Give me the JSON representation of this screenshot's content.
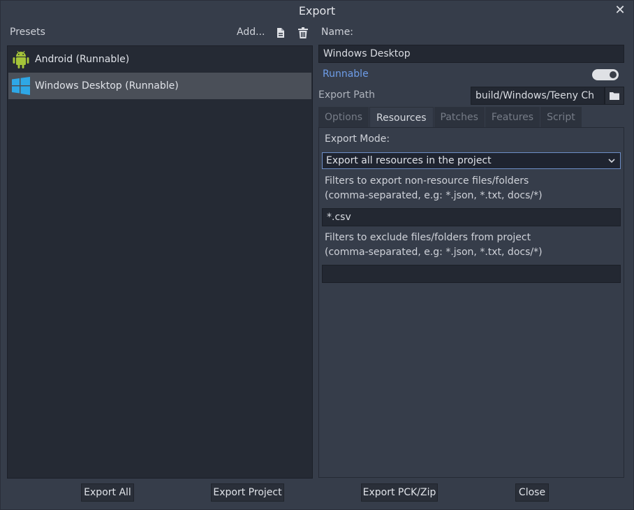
{
  "window": {
    "title": "Export"
  },
  "presets": {
    "label": "Presets",
    "add_label": "Add...",
    "items": [
      {
        "label": "Android (Runnable)",
        "icon": "android-icon",
        "selected": false
      },
      {
        "label": "Windows Desktop (Runnable)",
        "icon": "windows-icon",
        "selected": true
      }
    ]
  },
  "details": {
    "name_label": "Name:",
    "name_value": "Windows Desktop",
    "runnable_label": "Runnable",
    "runnable_on": true,
    "export_path_label": "Export Path",
    "export_path_value": "build/Windows/Teeny Ch",
    "tabs": [
      {
        "label": "Options",
        "active": false
      },
      {
        "label": "Resources",
        "active": true
      },
      {
        "label": "Patches",
        "active": false
      },
      {
        "label": "Features",
        "active": false
      },
      {
        "label": "Script",
        "active": false
      }
    ]
  },
  "resources": {
    "export_mode_label": "Export Mode:",
    "export_mode_value": "Export all resources in the project",
    "include_filter_label_1": "Filters to export non-resource files/folders",
    "include_filter_label_2": "(comma-separated, e.g: *.json, *.txt, docs/*)",
    "include_filter_value": "*.csv",
    "exclude_filter_label_1": "Filters to exclude files/folders from project",
    "exclude_filter_label_2": "(comma-separated, e.g: *.json, *.txt, docs/*)",
    "exclude_filter_value": ""
  },
  "footer": {
    "export_all": "Export All",
    "export_project": "Export Project",
    "export_pck": "Export PCK/Zip",
    "close": "Close"
  },
  "colors": {
    "accent": "#6e8ec7",
    "runnable_text": "#6e9de8",
    "android_green": "#a4c439",
    "windows_blue": "#2ea7e6"
  }
}
